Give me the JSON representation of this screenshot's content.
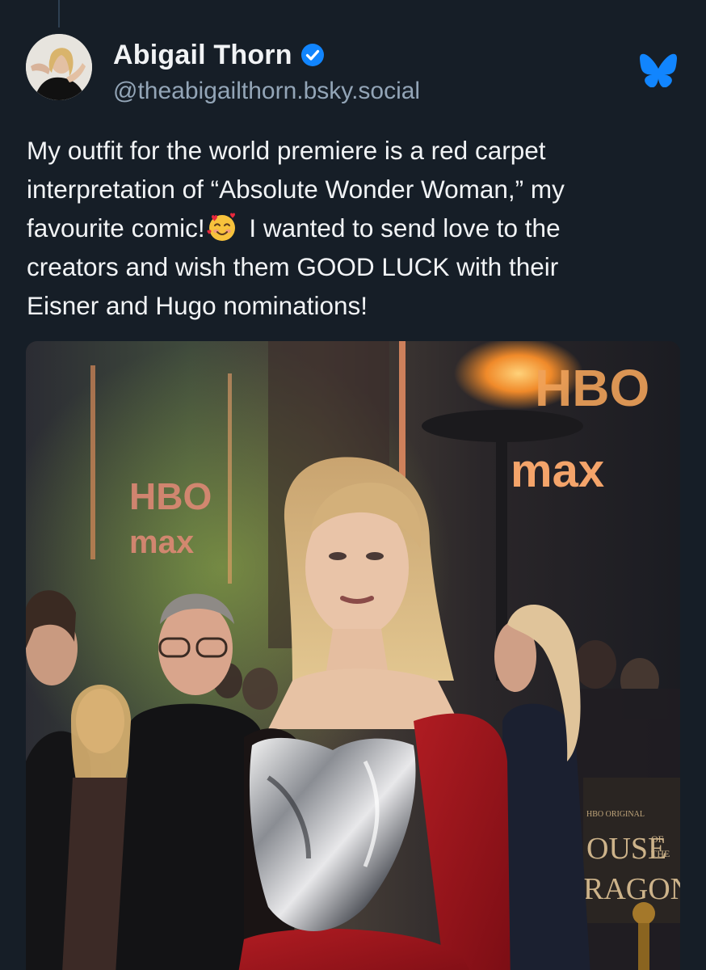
{
  "post": {
    "author": {
      "display_name": "Abigail Thorn",
      "handle": "@theabigailthorn.bsky.social",
      "verified": true
    },
    "text_lines": [
      "My outfit for the world premiere is a red carpet",
      "interpretation of “Absolute Wonder Woman,” my",
      "favourite comic!",
      " I wanted to send love to the",
      "creators and wish them GOOD LUCK with their",
      "Eisner and Hugo nominations!"
    ],
    "emoji": "smiling-face-with-hearts",
    "image": {
      "sign_text": {
        "hbo_left": "HBO",
        "max_left": "max",
        "hbo_right": "HBO",
        "max_right": "max",
        "hbo_original": "HBO ORIGINAL",
        "show_title_1": "OUSE",
        "show_title_of": "OF",
        "show_title_the": "THE",
        "show_title_2": "RAGON"
      }
    }
  },
  "colors": {
    "background": "#161e27",
    "text": "#f1f3f5",
    "handle": "#93a5b7",
    "verified": "#1185fe",
    "bluesky": "#1185fe"
  },
  "icons": {
    "verified": "verified-check-icon",
    "app": "bluesky-butterfly-icon"
  }
}
